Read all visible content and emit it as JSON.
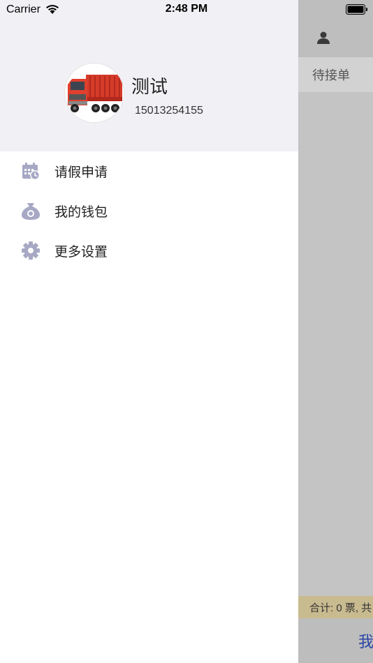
{
  "status_bar": {
    "carrier": "Carrier",
    "time": "2:48 PM"
  },
  "drawer": {
    "profile": {
      "name": "测试",
      "phone": "15013254155",
      "avatar_icon": "truck-avatar"
    },
    "menu": [
      {
        "label": "请假申请",
        "icon": "calendar-clock-icon"
      },
      {
        "label": "我的钱包",
        "icon": "money-bag-icon"
      },
      {
        "label": "更多设置",
        "icon": "gear-icon"
      }
    ]
  },
  "main_page": {
    "tab_label": "待接单",
    "summary_text": "合计: 0 票, 共",
    "bottom_text": "我"
  },
  "colors": {
    "icon": "#a6a8c4",
    "drawer_header_bg": "#f1f1f5",
    "summary_bg": "#c9bb90",
    "overlay": "#c4c4c4",
    "bottom_text": "#2b44a6"
  }
}
